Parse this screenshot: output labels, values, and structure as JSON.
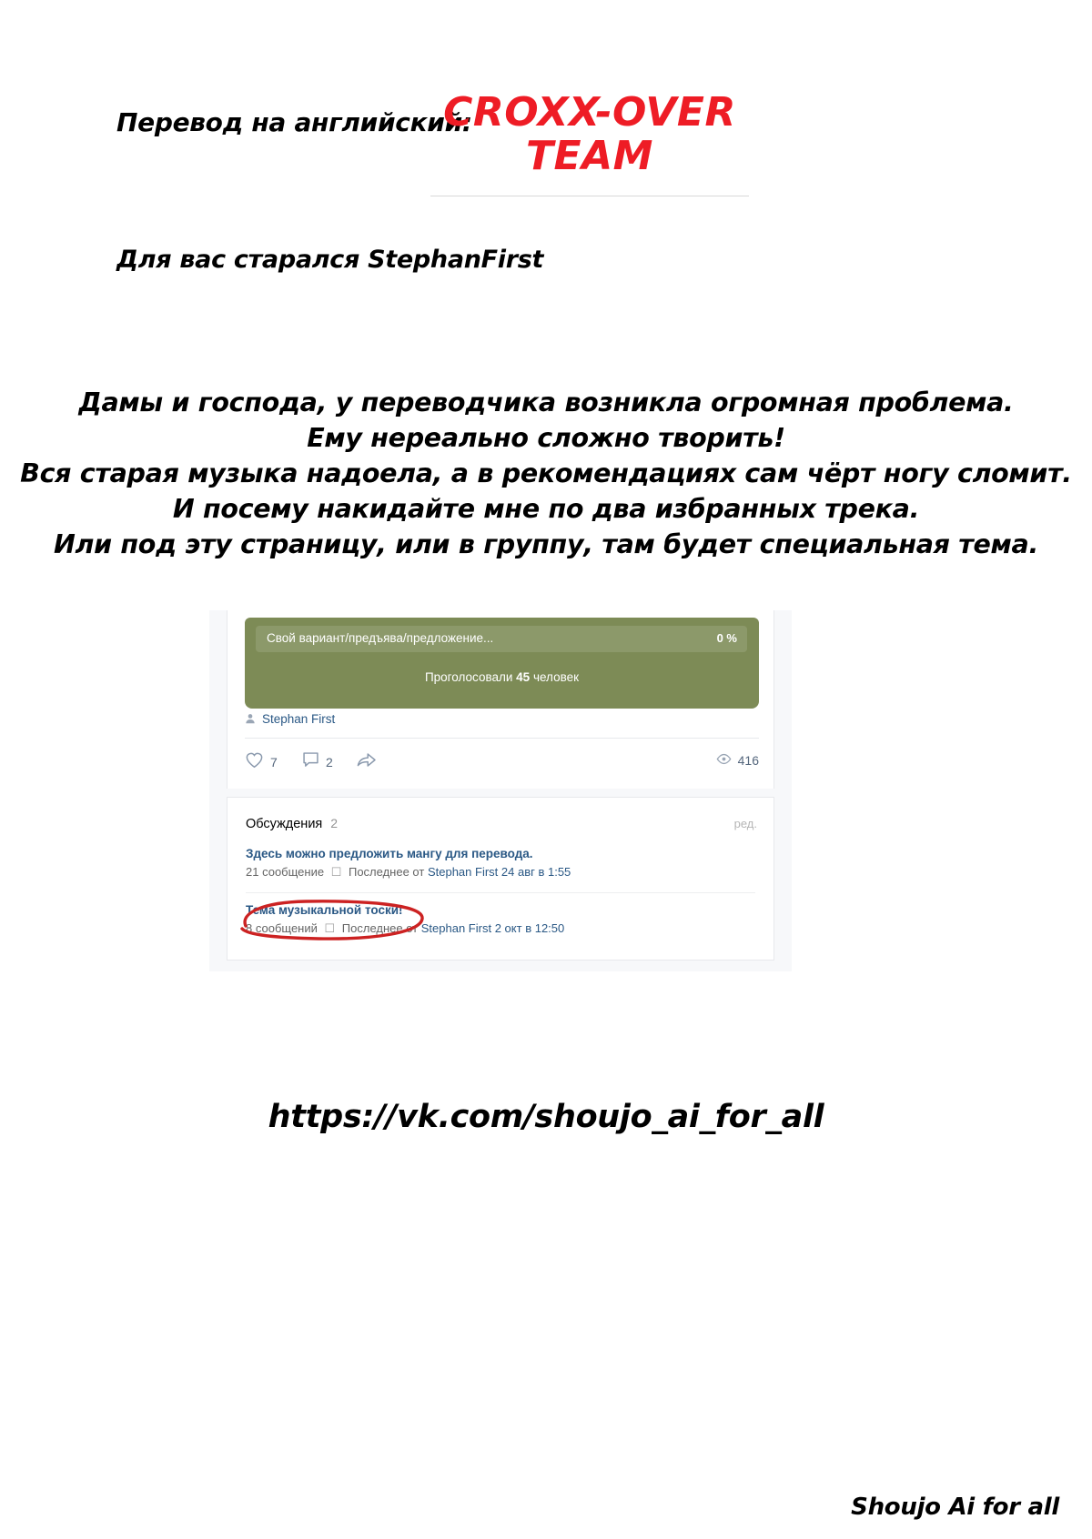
{
  "header": {
    "translation_label": "Перевод на английский:",
    "team_name_line1": "CROXX-OVER",
    "team_name_line2": "TEAM",
    "team_color": "#ee1c25",
    "credit_line": "Для вас старался StephanFirst"
  },
  "message": {
    "lines": [
      "Дамы и господа, у переводчика возникла огромная проблема.",
      "Ему нереально сложно творить!",
      "Вся старая музыка надоела, а в рекомендациях сам чёрт ногу сломит.",
      "И посему накидайте мне по два избранных трека.",
      "Или под эту страницу, или в группу, там будет специальная тема."
    ]
  },
  "vk_screenshot": {
    "poll": {
      "option_label": "Свой вариант/предъява/предложение...",
      "option_percent": "0 %",
      "voters_prefix": "Проголосовали",
      "voters_count": "45",
      "voters_suffix": "человек",
      "background_color": "#7d8b56"
    },
    "post": {
      "author": "Stephan First",
      "likes": "7",
      "comments": "2",
      "views": "416"
    },
    "discussions": {
      "title": "Обсуждения",
      "count": "2",
      "edit_label": "ред.",
      "topics": [
        {
          "title": "Здесь можно предложить мангу для перевода.",
          "messages": "21 сообщение",
          "last_prefix": "Последнее от",
          "last_author": "Stephan First",
          "last_date": "24 авг в 1:55"
        },
        {
          "title": "Тема музыкальной тоски!",
          "messages": "8 сообщений",
          "last_prefix": "Последнее от",
          "last_author": "Stephan First",
          "last_date": "2 окт в 12:50"
        }
      ]
    },
    "annotation_color": "#cc2222"
  },
  "footer": {
    "url": "https://vk.com/shoujo_ai_for_all",
    "signature": "Shoujo Ai for all"
  }
}
